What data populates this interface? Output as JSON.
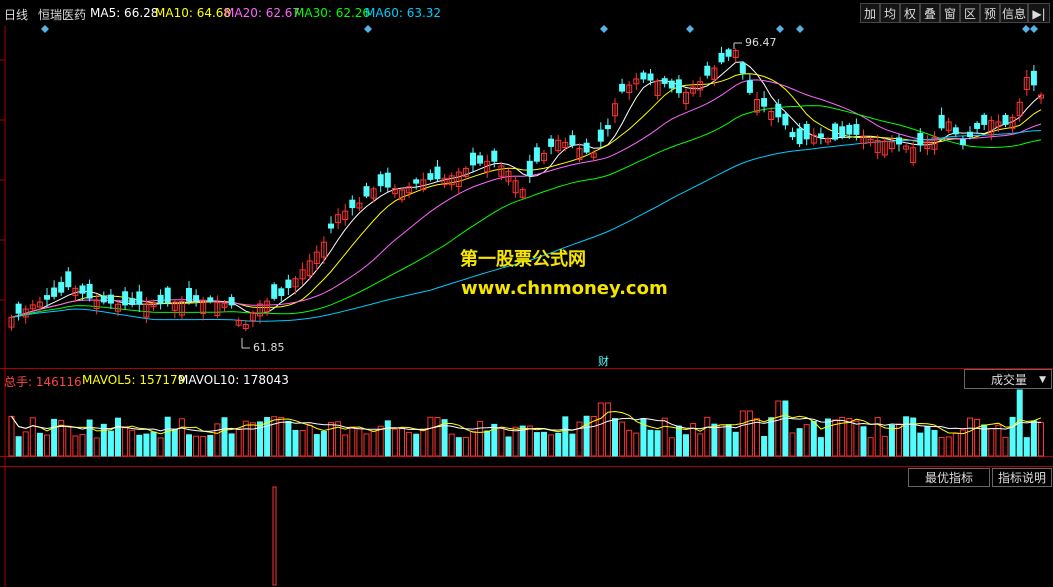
{
  "header": {
    "period": "日线",
    "stock_name": "恒瑞医药",
    "ma": [
      {
        "label": "MA5: 66.28",
        "color": "#ffffff"
      },
      {
        "label": "MA10: 64.68",
        "color": "#ffff00"
      },
      {
        "label": "MA20: 62.67",
        "color": "#ff66ff"
      },
      {
        "label": "MA30: 62.26",
        "color": "#00ff00"
      },
      {
        "label": "MA60: 63.32",
        "color": "#00ccff"
      }
    ]
  },
  "toolbar": {
    "buttons": [
      "加",
      "均",
      "权",
      "叠",
      "窗",
      "区",
      "预",
      "信息",
      "▶|"
    ]
  },
  "price_chart": {
    "max_label": "96.47",
    "min_label": "61.85",
    "event_marker": "财"
  },
  "volume": {
    "total_label": "总手: 146116",
    "mavol5_label": "MAVOL5: 157179",
    "mavol10_label": "MAVOL10: 178043",
    "indicator_select": "成交量"
  },
  "indicator_buttons": {
    "best": "最优指标",
    "help": "指标说明"
  },
  "watermark": {
    "line1": "第一股票公式网",
    "line2": "www.chnmoney.com"
  },
  "colors": {
    "up": "#ff3333",
    "down": "#54fcfc",
    "grid": "#7a0000"
  }
}
